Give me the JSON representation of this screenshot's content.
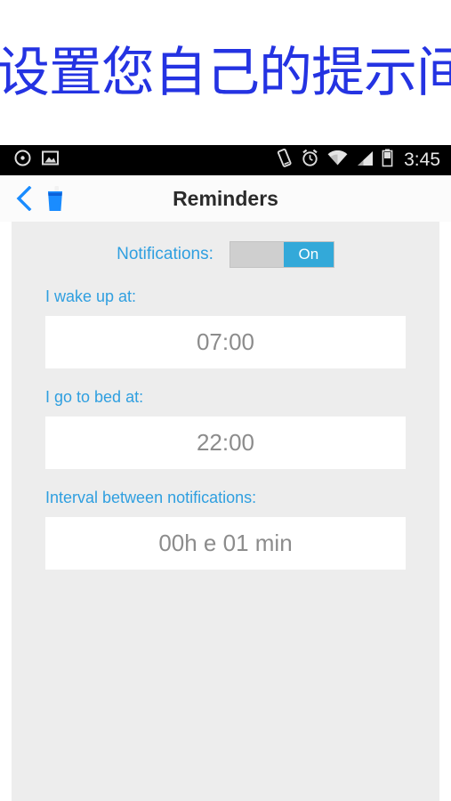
{
  "promo": {
    "heading": "设置您自己的提示间隔",
    "heading_color": "#2433e2"
  },
  "status_bar": {
    "time": "3:45",
    "left_icons": [
      "record-circle-icon",
      "gallery-image-icon"
    ],
    "right_icons": [
      "vibrate-icon",
      "alarm-clock-icon",
      "wifi-icon",
      "cellular-signal-icon",
      "battery-icon"
    ],
    "background": "#000000"
  },
  "app_bar": {
    "back_icon": "back-chevron-icon",
    "app_icon": "water-glass-icon",
    "title": "Reminders",
    "accent": "#1a8cff"
  },
  "content": {
    "background": "#ededed",
    "notifications": {
      "label": "Notifications:",
      "toggle_state": "On",
      "toggle_on_color": "#33a9d9",
      "toggle_track_color": "#cfcfcf"
    },
    "fields": [
      {
        "label": "I wake up at:",
        "value": "07:00"
      },
      {
        "label": "I go to bed at:",
        "value": "22:00"
      },
      {
        "label": "Interval between notifications:",
        "value": "00h e 01 min"
      }
    ],
    "label_color": "#2f9fe0",
    "value_color": "#8c8c8c"
  }
}
